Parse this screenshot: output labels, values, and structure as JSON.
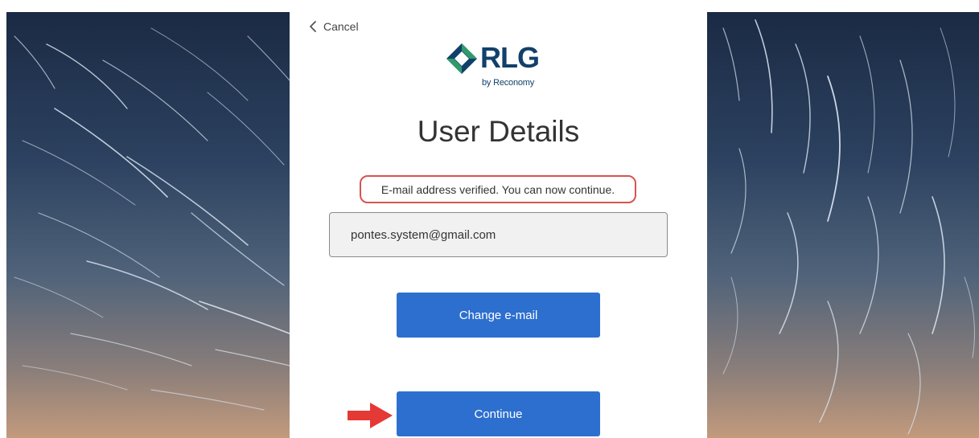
{
  "nav": {
    "cancel_label": "Cancel"
  },
  "logo": {
    "name": "RLG",
    "tagline": "by Reconomy"
  },
  "page_title": "User Details",
  "verification_message": "E-mail address verified. You can now continue.",
  "email_field": {
    "value": "pontes.system@gmail.com"
  },
  "buttons": {
    "change_email_label": "Change e-mail",
    "continue_label": "Continue"
  },
  "colors": {
    "primary_button": "#2d6fcf",
    "highlight_border": "#d9534f",
    "pointer_arrow": "#e53935",
    "logo_navy": "#11406b",
    "logo_green": "#2f9b6a"
  },
  "icons": {
    "cancel": "chevron-left-icon",
    "pointer": "arrow-right-icon"
  }
}
